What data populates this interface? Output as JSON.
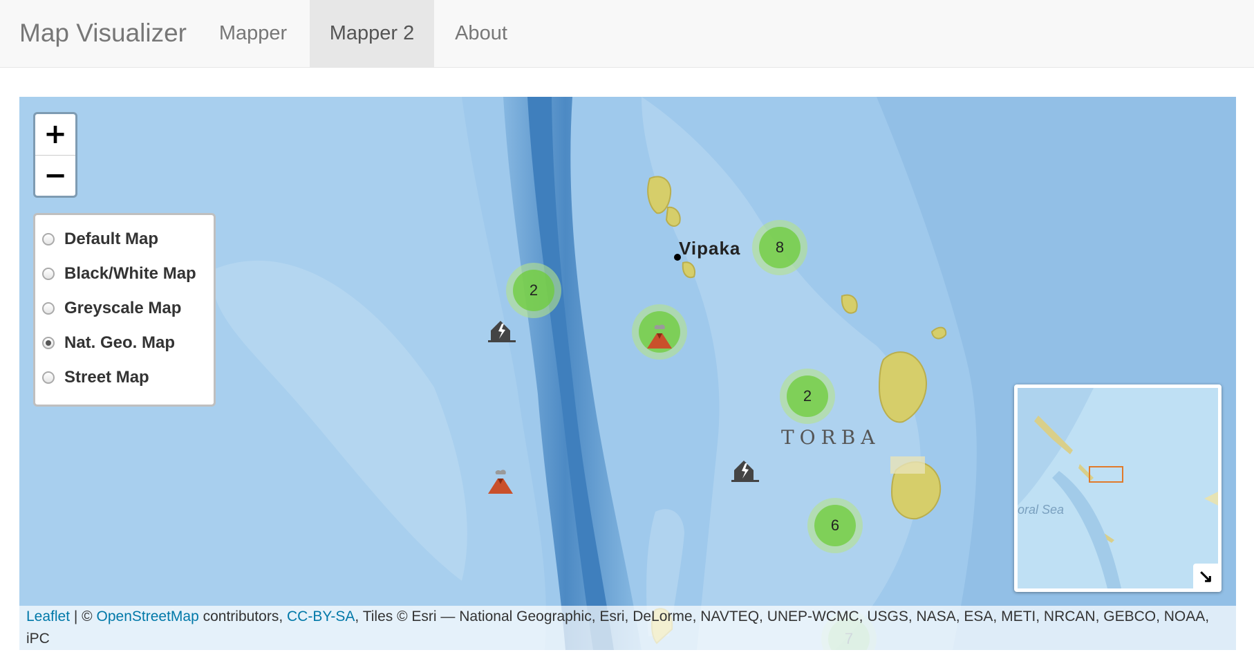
{
  "navbar": {
    "brand": "Map Visualizer",
    "links": [
      {
        "label": "Mapper",
        "active": false
      },
      {
        "label": "Mapper 2",
        "active": true
      },
      {
        "label": "About",
        "active": false
      }
    ]
  },
  "map": {
    "zoom_in_label": "+",
    "zoom_out_label": "−",
    "layers": [
      {
        "label": "Default Map",
        "checked": false
      },
      {
        "label": "Black/White Map",
        "checked": false
      },
      {
        "label": "Greyscale Map",
        "checked": false
      },
      {
        "label": "Nat. Geo. Map",
        "checked": true
      },
      {
        "label": "Street Map",
        "checked": false
      }
    ],
    "place_labels": {
      "vipaka": "Vipaka",
      "torba": "TORBA"
    },
    "clusters": [
      {
        "count": "2"
      },
      {
        "count": "8"
      },
      {
        "count": "2"
      },
      {
        "count": "6"
      },
      {
        "count": "7"
      }
    ],
    "markers": [
      {
        "icon": "volcano-icon"
      },
      {
        "icon": "volcano-icon"
      },
      {
        "icon": "earthquake-icon"
      },
      {
        "icon": "earthquake-icon"
      }
    ],
    "minimap": {
      "sea_label": "oral Sea",
      "toggle_icon": "↘"
    },
    "attribution": {
      "leaflet": "Leaflet",
      "separator": " | © ",
      "osm": "OpenStreetMap",
      "contributors": " contributors, ",
      "license": "CC-BY-SA",
      "tiles": ", Tiles © Esri — National Geographic, Esri, DeLorme, NAVTEQ, UNEP-WCMC, USGS, NASA, ESA, METI, NRCAN, GEBCO, NOAA, iPC"
    }
  },
  "colors": {
    "ocean": "#9cc6ea",
    "trench": "#4f8fc9",
    "land": "#d8d070",
    "cluster_outer": "#b5e28c",
    "cluster_inner": "#6ecc39",
    "link": "#0078a8"
  }
}
